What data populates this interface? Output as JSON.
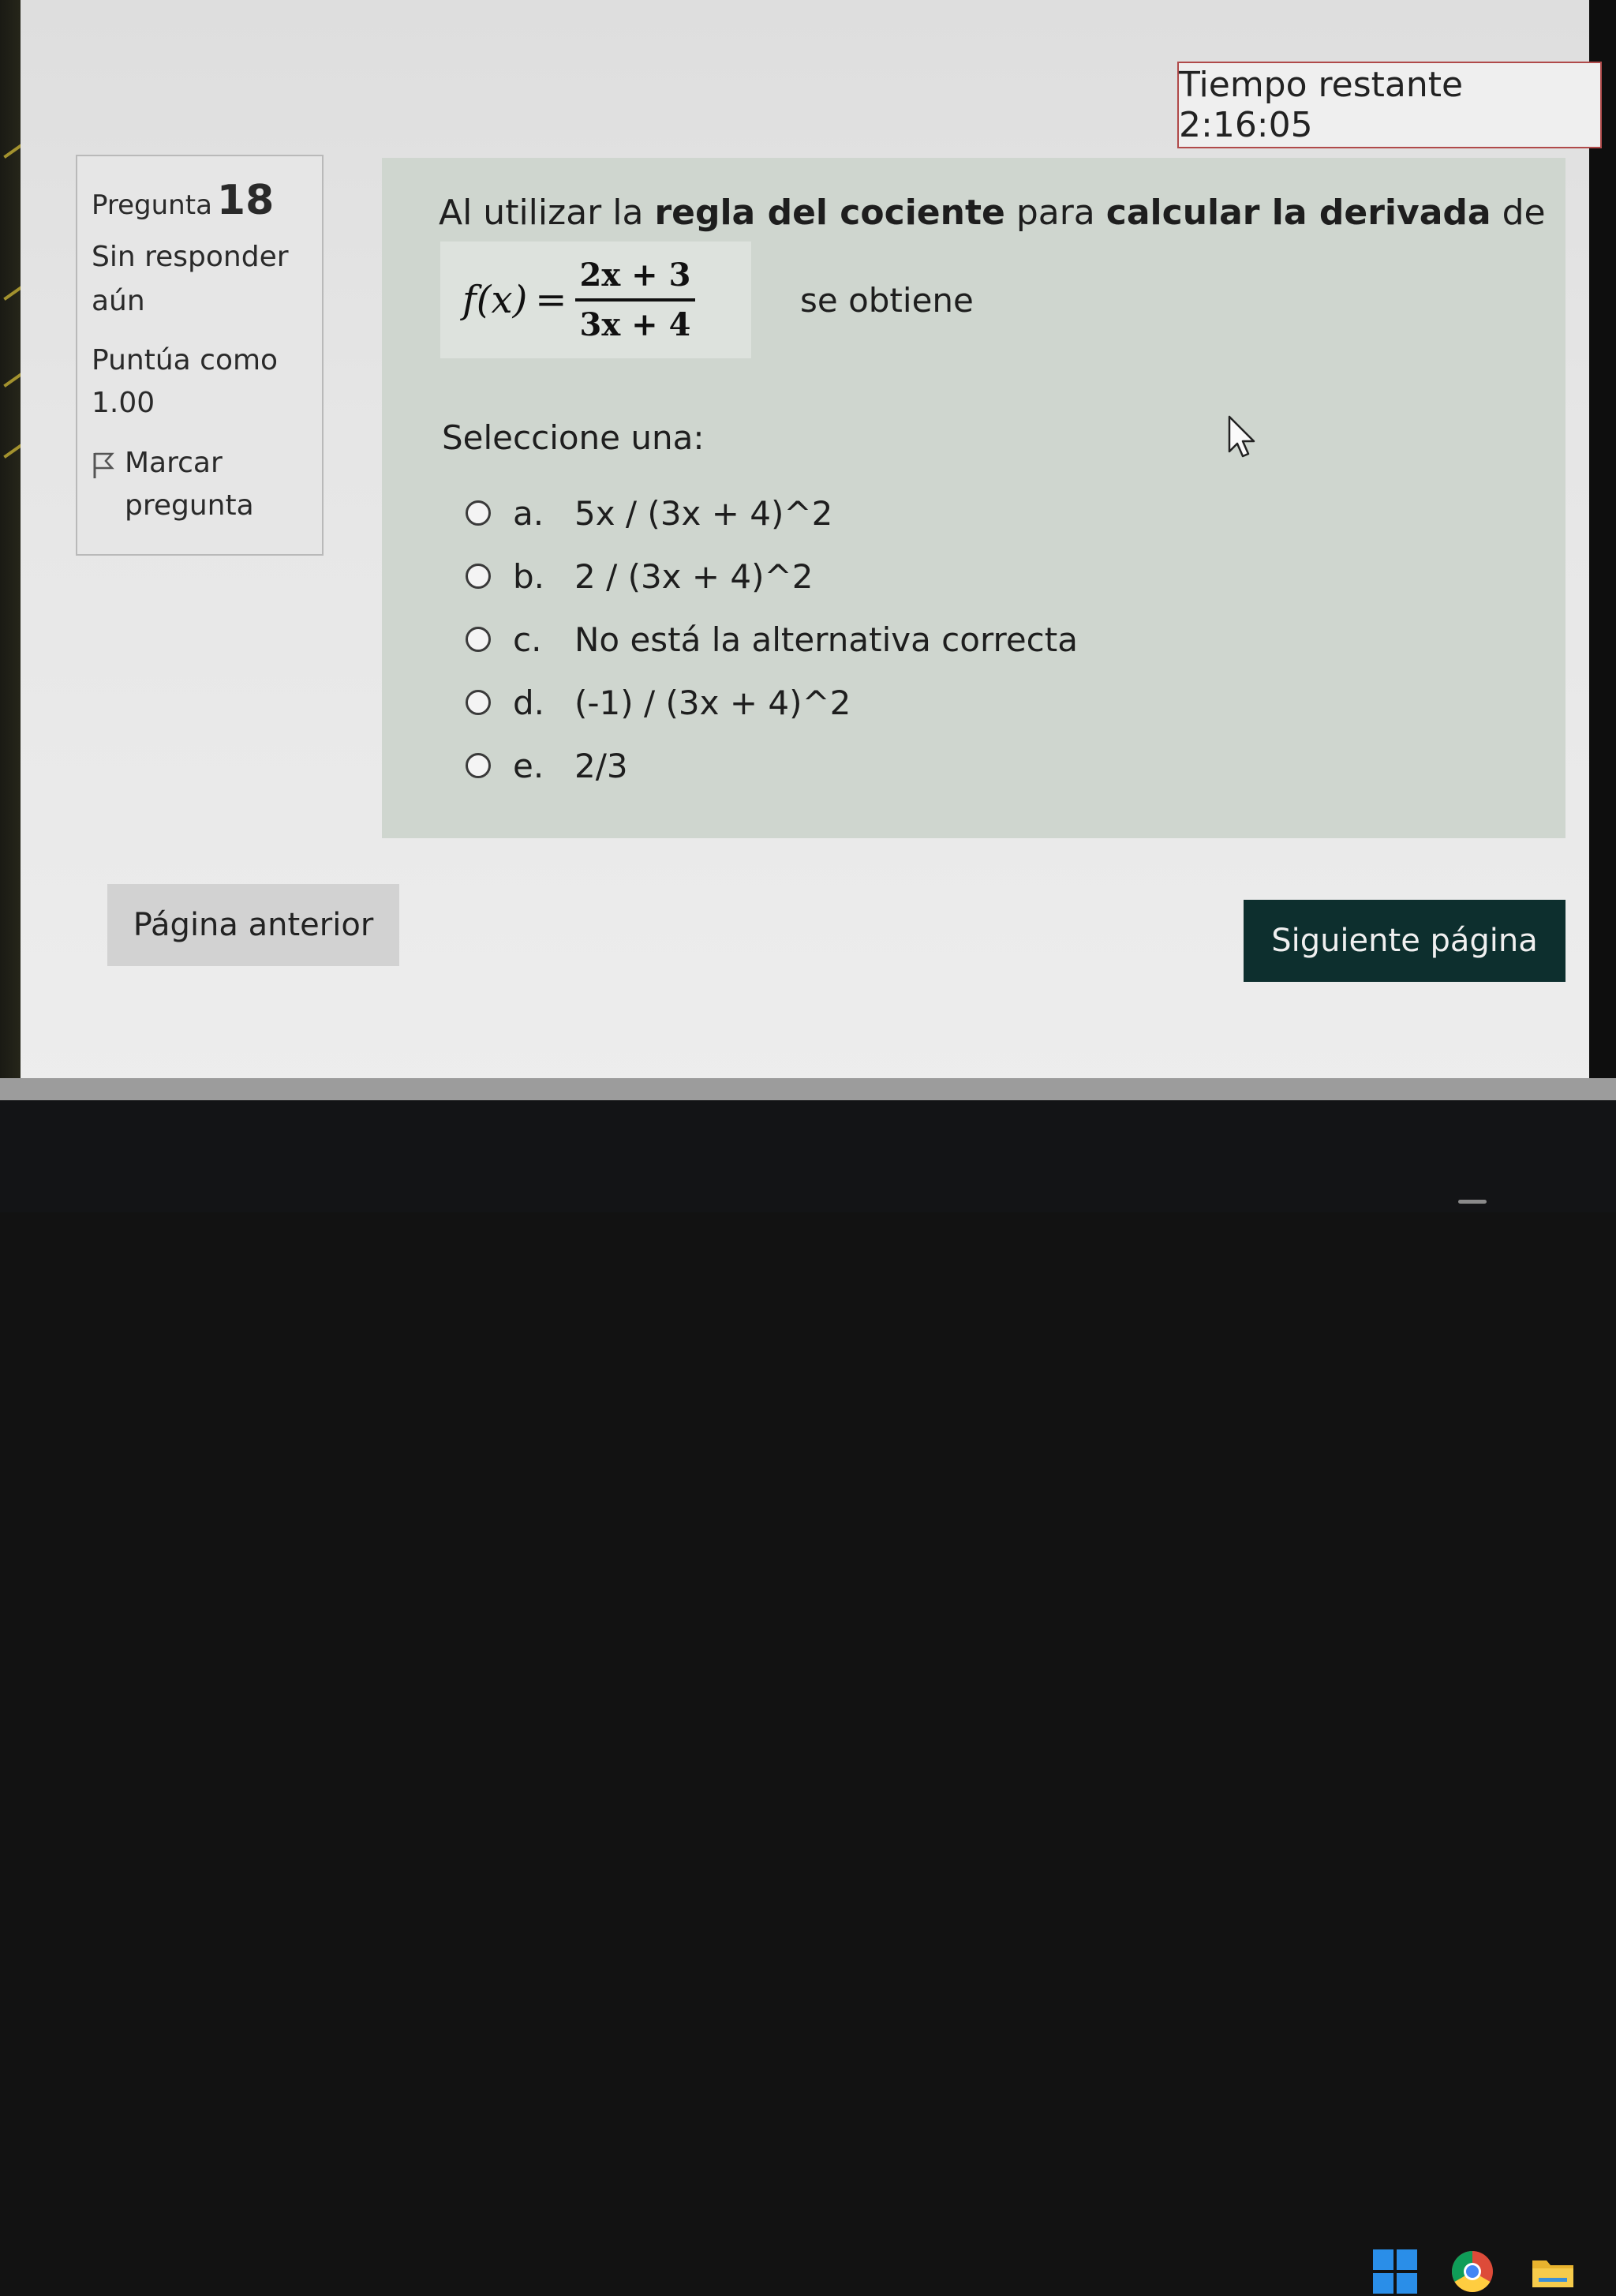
{
  "timer": {
    "label": "Tiempo restante 2:16:05"
  },
  "question_info": {
    "label": "Pregunta",
    "number": "18",
    "state_line1": "Sin responder",
    "state_line2": "aún",
    "grade_label": "Puntúa como",
    "grade_value": "1.00",
    "flag_line1": "Marcar",
    "flag_line2": "pregunta"
  },
  "question": {
    "text_1": "Al utilizar la ",
    "bold_1": "regla del cociente",
    "text_2": " para ",
    "bold_2": "calcular la derivada",
    "text_3": " de",
    "formula": {
      "lhs": "f(x)",
      "eq": "=",
      "numerator": "2x + 3",
      "denominator": "3x + 4"
    },
    "suffix": "se obtiene",
    "select_prompt": "Seleccione una:",
    "options": [
      {
        "letter": "a.",
        "text": "5x / (3x + 4)^2"
      },
      {
        "letter": "b.",
        "text": "2 / (3x + 4)^2"
      },
      {
        "letter": "c.",
        "text": "No está la alternativa correcta"
      },
      {
        "letter": "d.",
        "text": "(-1) / (3x + 4)^2"
      },
      {
        "letter": "e.",
        "text": "2/3"
      }
    ]
  },
  "navigation": {
    "prev_label": "Página anterior",
    "next_label": "Siguiente página"
  },
  "colors": {
    "next_button_bg": "#0d2f2e",
    "timer_border": "#b04a4a",
    "question_bg": "#cfd6cf"
  },
  "taskbar": {
    "icons": [
      "windows-start-icon",
      "chrome-icon",
      "file-explorer-icon"
    ]
  }
}
